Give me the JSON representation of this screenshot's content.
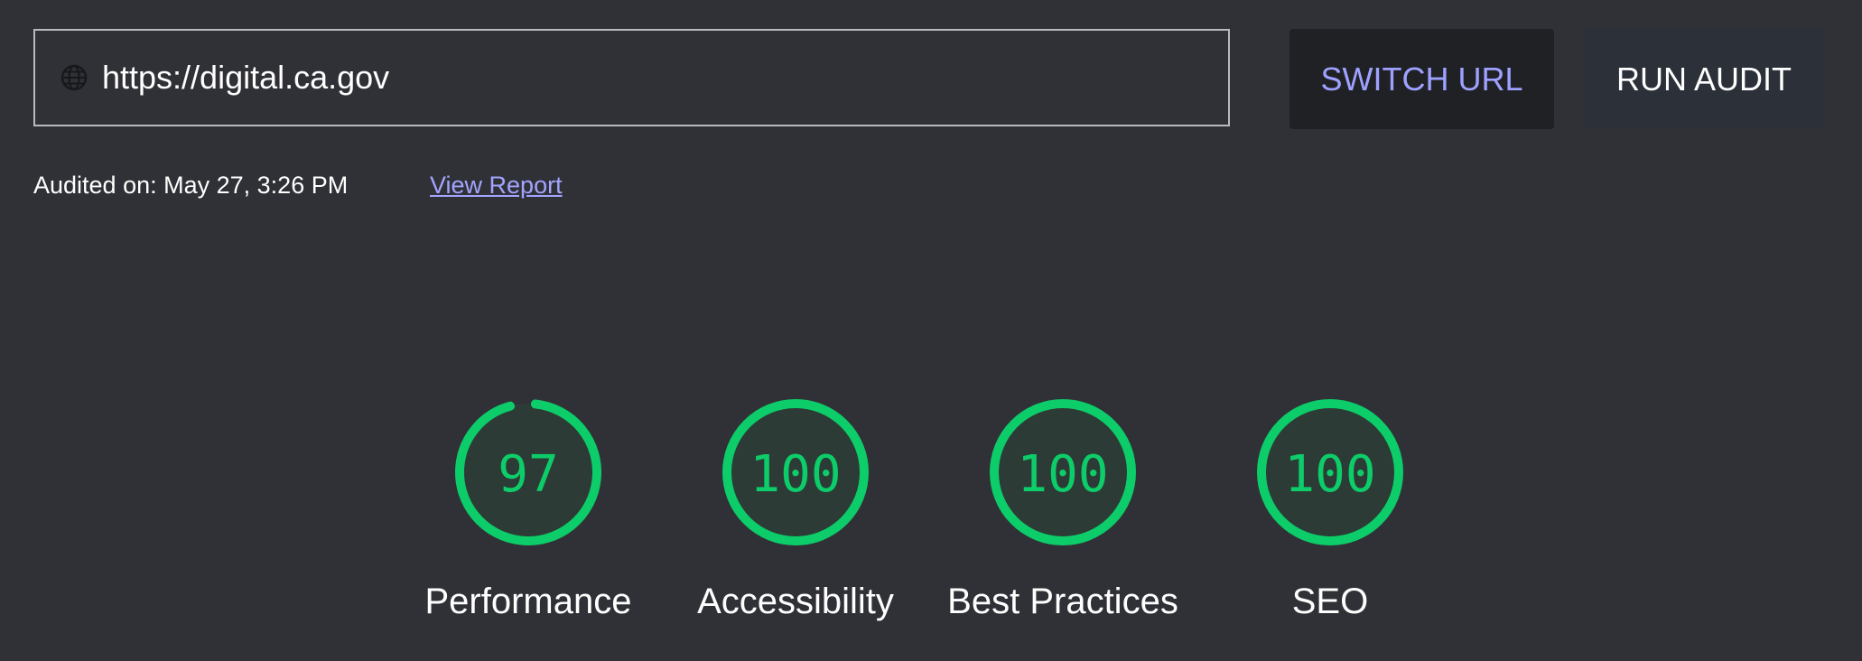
{
  "url_input": {
    "value": "https://digital.ca.gov",
    "icon": "globe-icon"
  },
  "buttons": {
    "switch_url": "SWITCH URL",
    "run_audit": "RUN AUDIT"
  },
  "audit_info": {
    "audited_on": "Audited on: May 27, 3:26 PM",
    "view_report": "View Report"
  },
  "colors": {
    "background": "#303136",
    "score_green": "#0ccd69",
    "gauge_fill": "#2c3b35",
    "link": "#a2a4ff",
    "switch_text": "#9ea1ff"
  },
  "scores": [
    {
      "label": "Performance",
      "value": 97
    },
    {
      "label": "Accessibility",
      "value": 100
    },
    {
      "label": "Best Practices",
      "value": 100
    },
    {
      "label": "SEO",
      "value": 100
    }
  ]
}
